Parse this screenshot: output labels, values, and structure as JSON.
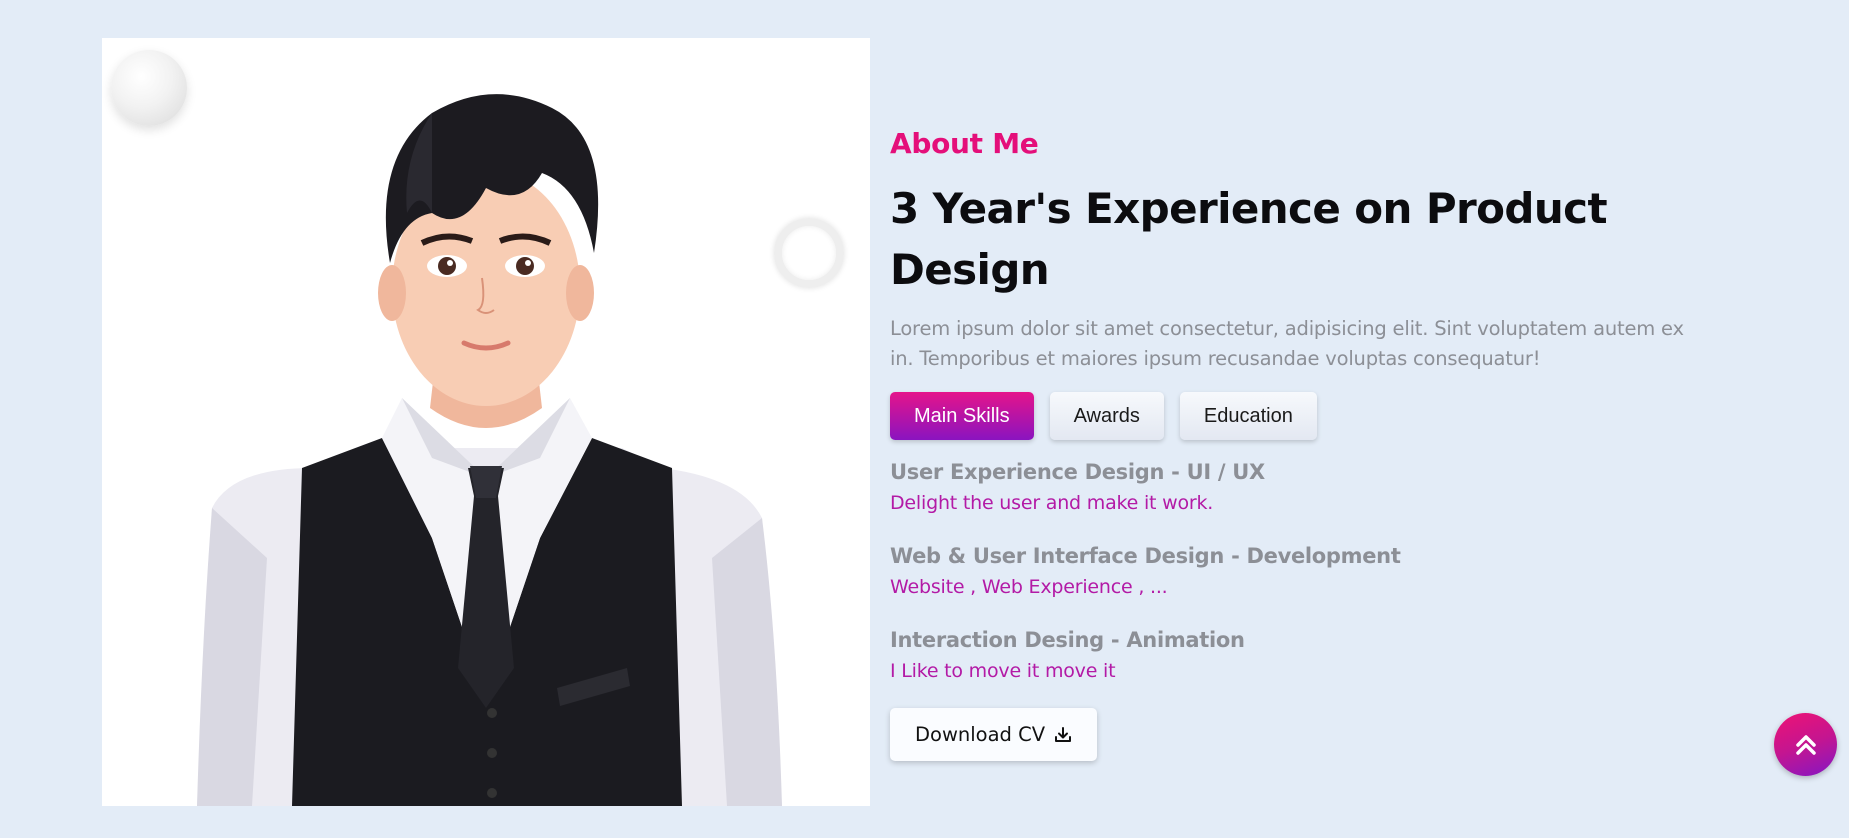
{
  "about": {
    "eyebrow": "About Me",
    "headline": "3 Year's Experience on Product Design",
    "intro": "Lorem ipsum dolor sit amet consectetur, adipisicing elit. Sint voluptatem autem ex in. Temporibus et maiores ipsum recusandae voluptas consequatur!"
  },
  "tabs": [
    {
      "label": "Main Skills",
      "active": true
    },
    {
      "label": "Awards",
      "active": false
    },
    {
      "label": "Education",
      "active": false
    }
  ],
  "skills": [
    {
      "title": "User Experience Design - UI / UX",
      "desc": "Delight the user and make it work."
    },
    {
      "title": "Web & User Interface Design - Development",
      "desc": "Website , Web Experience , ..."
    },
    {
      "title": "Interaction Desing - Animation",
      "desc": "I Like to move it move it"
    }
  ],
  "cv": {
    "label": "Download CV",
    "icon": "download-icon"
  },
  "scroll_top": {
    "icon": "double-chevron-up-icon"
  },
  "colors": {
    "accent": "#e40f7a",
    "accent_purple": "#8a14c0",
    "skill_desc": "#b31aa6",
    "background": "#e3ecf7"
  }
}
